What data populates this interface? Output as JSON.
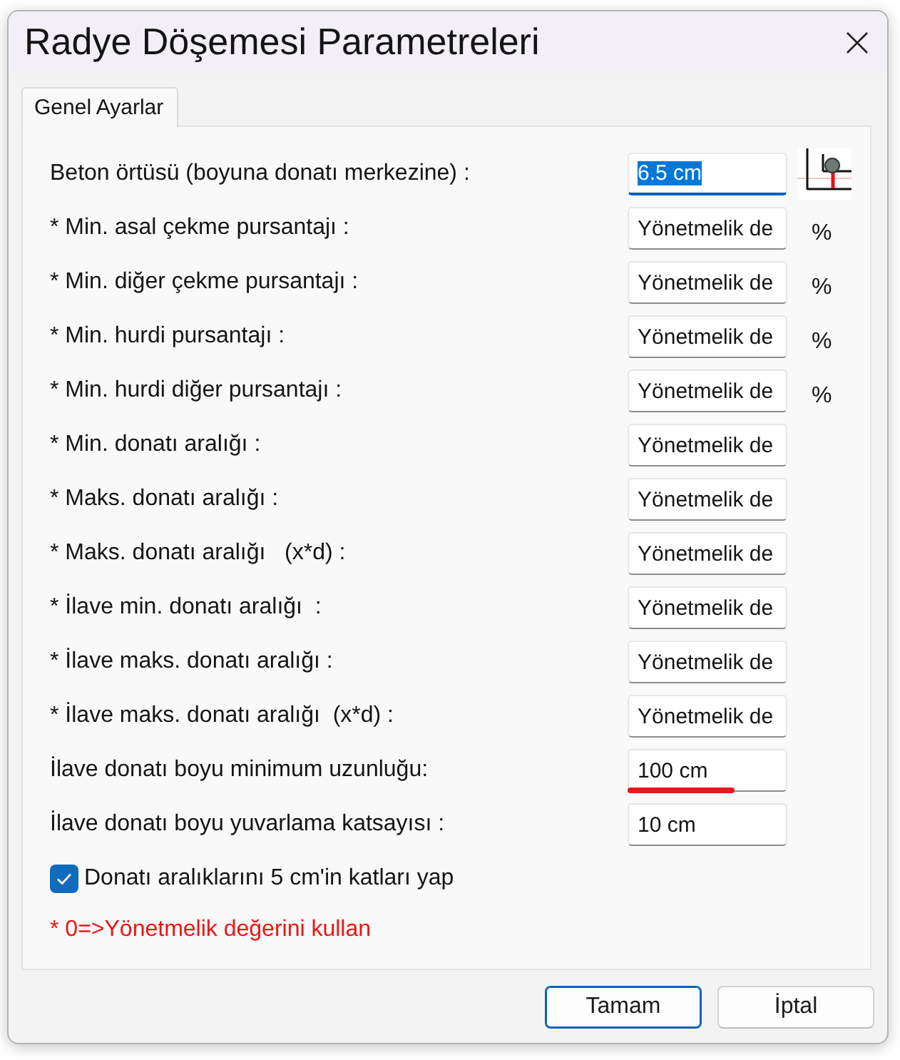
{
  "window": {
    "title": "Radye Döşemesi Parametreleri"
  },
  "tabs": [
    {
      "label": "Genel Ayarlar",
      "selected": true
    }
  ],
  "rows": [
    {
      "kind": "diagram",
      "label": "Beton örtüsü (boyuna donatı merkezine) :",
      "value": "6.5 cm",
      "focused": true,
      "underline": false
    },
    {
      "kind": "plain",
      "label": "* Min. asal çekme pursantajı :",
      "value": "Yönetmelik de",
      "unit": "%",
      "focused": false,
      "underline": false
    },
    {
      "kind": "plain",
      "label": "* Min. diğer çekme pursantajı :",
      "value": "Yönetmelik de",
      "unit": "%",
      "focused": false,
      "underline": false
    },
    {
      "kind": "plain",
      "label": "* Min. hurdi pursantajı :",
      "value": "Yönetmelik de",
      "unit": "%",
      "focused": false,
      "underline": false
    },
    {
      "kind": "plain",
      "label": "* Min. hurdi diğer pursantajı :",
      "value": "Yönetmelik de",
      "unit": "%",
      "focused": false,
      "underline": false
    },
    {
      "kind": "plain",
      "label": "* Min. donatı aralığı :",
      "value": "Yönetmelik de",
      "focused": false,
      "underline": false
    },
    {
      "kind": "plain",
      "label": "* Maks. donatı aralığı :",
      "value": "Yönetmelik de",
      "focused": false,
      "underline": false
    },
    {
      "kind": "plain",
      "label": "* Maks. donatı aralığı   (x*d) :",
      "value": "Yönetmelik de",
      "focused": false,
      "underline": false
    },
    {
      "kind": "plain",
      "label": "* İlave min. donatı aralığı  :",
      "value": "Yönetmelik de",
      "focused": false,
      "underline": false
    },
    {
      "kind": "plain",
      "label": "* İlave maks. donatı aralığı :",
      "value": "Yönetmelik de",
      "focused": false,
      "underline": false
    },
    {
      "kind": "plain",
      "label": "* İlave maks. donatı aralığı  (x*d) :",
      "value": "Yönetmelik de",
      "focused": false,
      "underline": false
    },
    {
      "kind": "plain",
      "label": "İlave donatı boyu minimum uzunluğu:",
      "value": "100 cm",
      "focused": false,
      "underline": true
    },
    {
      "kind": "plain",
      "label": "İlave donatı boyu yuvarlama katsayısı :",
      "value": "10 cm",
      "focused": false,
      "underline": false
    }
  ],
  "checkbox": {
    "label": "Donatı aralıklarını 5 cm'in katları yap",
    "checked": true
  },
  "note": "* 0=>Yönetmelik değerini kullan",
  "buttons": [
    {
      "label": "Tamam",
      "default": true
    },
    {
      "label": "İptal",
      "default": false
    }
  ]
}
